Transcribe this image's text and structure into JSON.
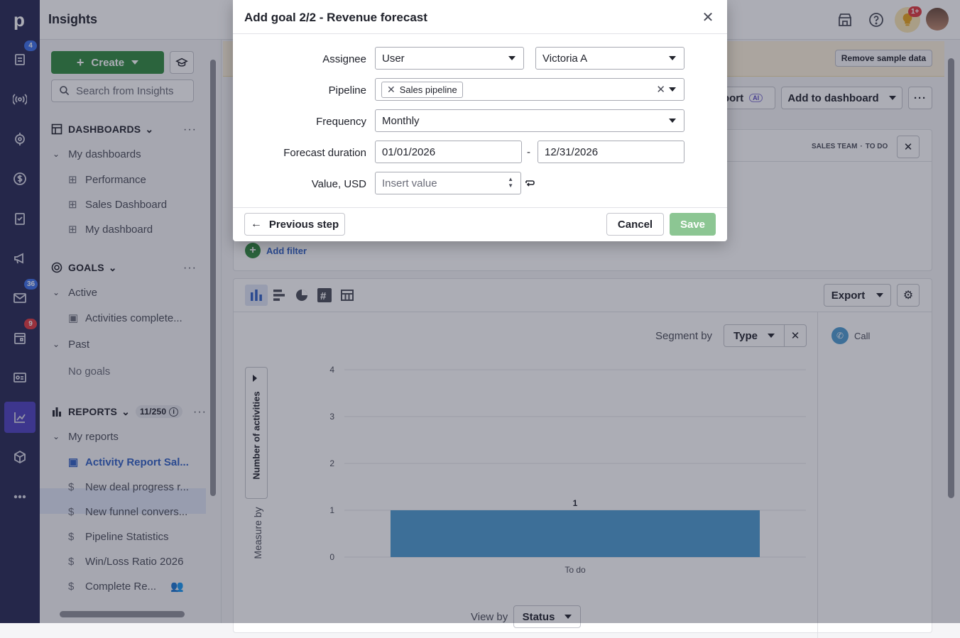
{
  "app": {
    "title": "Insights",
    "notifications_badge": "1+"
  },
  "rail": {
    "items": [
      {
        "icon": "pipedrive-logo-icon"
      },
      {
        "icon": "leads-icon",
        "badge": "4",
        "badge_color": "#3b6ee8"
      },
      {
        "icon": "deals-signal-icon"
      },
      {
        "icon": "target-icon"
      },
      {
        "icon": "dollar-icon"
      },
      {
        "icon": "clipboard-icon"
      },
      {
        "icon": "megaphone-icon"
      },
      {
        "icon": "mail-icon",
        "badge": "36",
        "badge_color": "#3b6ee8"
      },
      {
        "icon": "calendar-icon",
        "badge": "9",
        "badge_color": "#e0383e"
      },
      {
        "icon": "contacts-card-icon"
      },
      {
        "icon": "insights-chart-icon",
        "active": true
      },
      {
        "icon": "products-box-icon"
      },
      {
        "icon": "more-icon"
      }
    ]
  },
  "sidebar": {
    "create_label": "Create",
    "search_placeholder": "Search from Insights",
    "dashboards": {
      "title": "DASHBOARDS",
      "group": "My dashboards",
      "items": [
        "Performance",
        "Sales Dashboard",
        "My dashboard"
      ]
    },
    "goals": {
      "title": "GOALS",
      "active_label": "Active",
      "active_items": [
        "Activities complete..."
      ],
      "past_label": "Past",
      "past_empty": "No goals"
    },
    "reports": {
      "title": "REPORTS",
      "count": "11/250",
      "group": "My reports",
      "items": [
        {
          "label": "Activity Report Sal...",
          "icon": "calendar-icon",
          "selected": true
        },
        {
          "label": "New deal progress r...",
          "icon": "dollar-icon"
        },
        {
          "label": "New funnel convers...",
          "icon": "dollar-icon"
        },
        {
          "label": "Pipeline Statistics",
          "icon": "dollar-icon"
        },
        {
          "label": "Win/Loss Ratio 2026",
          "icon": "dollar-icon"
        },
        {
          "label": "Complete Re...",
          "icon": "dollar-icon",
          "shared": true
        }
      ]
    }
  },
  "banner": {
    "button": "Remove sample data"
  },
  "toolbar": {
    "report_partial": "port",
    "ai_badge": "AI",
    "add_to_dashboard": "Add to dashboard"
  },
  "filter_card": {
    "tags": [
      "SALES TEAM",
      "TO DO"
    ],
    "add_filter": "Add filter"
  },
  "chart_card": {
    "export": "Export",
    "segment_by_label": "Segment by",
    "segment_value": "Type",
    "view_by_label": "View by",
    "view_by_value": "Status",
    "measure_by_label": "Measure by",
    "yaxis_button": "Number of activities",
    "legend": [
      {
        "label": "Call",
        "color": "#4c9bd1"
      }
    ]
  },
  "chart_data": {
    "type": "bar",
    "categories": [
      "To do"
    ],
    "series": [
      {
        "name": "Call",
        "values": [
          1
        ]
      }
    ],
    "ylim": [
      0,
      4
    ],
    "yticks": [
      "0",
      "1",
      "2",
      "3",
      "4"
    ],
    "ylabel": "Number of activities",
    "xlabel": "",
    "data_labels": [
      "1"
    ],
    "bar_color": "#4c9bd1",
    "grid": true
  },
  "modal": {
    "title": "Add goal 2/2 - Revenue forecast",
    "assignee_label": "Assignee",
    "assignee_type": "User",
    "assignee_value": "Victoria A",
    "pipeline_label": "Pipeline",
    "pipeline_tag": "Sales pipeline",
    "frequency_label": "Frequency",
    "frequency_value": "Monthly",
    "duration_label": "Forecast duration",
    "duration_start": "01/01/2026",
    "duration_sep": "-",
    "duration_end": "12/31/2026",
    "value_label": "Value, USD",
    "value_placeholder": "Insert value",
    "previous_step": "Previous step",
    "cancel": "Cancel",
    "save": "Save"
  }
}
